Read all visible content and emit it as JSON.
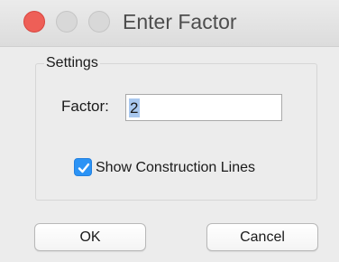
{
  "window": {
    "title": "Enter Factor",
    "controls": [
      "close-icon",
      "minimize-icon",
      "maximize-icon"
    ]
  },
  "settings_group": {
    "legend": "Settings",
    "factor": {
      "label": "Factor:",
      "value": "2"
    },
    "show_construction_lines": {
      "label": "Show Construction Lines",
      "checked": true
    }
  },
  "buttons": {
    "ok_label": "OK",
    "cancel_label": "Cancel"
  },
  "colors": {
    "close_button": "#ee5f57",
    "checkbox_accent": "#2b93f5",
    "selection_highlight": "#a9c8ef"
  }
}
